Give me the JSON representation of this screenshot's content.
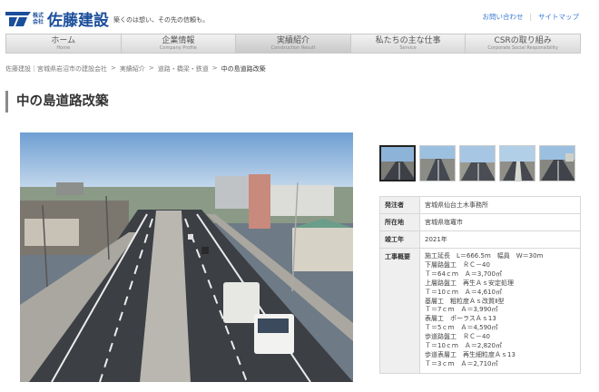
{
  "header": {
    "logo_small": "株式会社",
    "logo_name": "佐藤建設",
    "tagline": "築くのは想い、その先の信頼も。",
    "links": [
      "お問い合わせ",
      "サイトマップ"
    ]
  },
  "nav": [
    {
      "label": "ホーム",
      "sub": "Home"
    },
    {
      "label": "企業情報",
      "sub": "Company Profile"
    },
    {
      "label": "実績紹介",
      "sub": "Construction Result"
    },
    {
      "label": "私たちの主な仕事",
      "sub": "Service"
    },
    {
      "label": "CSRの取り組み",
      "sub": "Corporate Social Responsibility"
    }
  ],
  "breadcrumb": {
    "items": [
      "佐藤建設｜宮城県岩沼市の建設会社",
      "実績紹介",
      "道路・橋梁・鉄道"
    ],
    "current": "中の島道路改築",
    "separator": ">"
  },
  "page_title": "中の島道路改築",
  "project": {
    "rows": [
      {
        "key": "発注者",
        "value": "宮城県仙台土木事務所"
      },
      {
        "key": "所在地",
        "value": "宮城県塩竈市"
      },
      {
        "key": "竣工年",
        "value": "2021年"
      }
    ],
    "overview_key": "工事概要",
    "overview_lines": [
      "施工延長　L＝666.5m　幅員　W＝30m",
      "下層路盤工　ＲＣ－40",
      "Ｔ＝64ｃｍ　Ａ＝3,700㎡",
      "上層路盤工　再生Ａｓ安定処理",
      "Ｔ＝10ｃｍ　Ａ＝4,610㎡",
      "基層工　粗粒度Ａｓ改質Ⅱ型",
      "Ｔ＝7ｃｍ　Ａ＝3,990㎡",
      "表層工　ポーラスＡｓ13",
      "Ｔ＝5ｃｍ　Ａ＝4,590㎡",
      "歩道路盤工　ＲＣ－40",
      "Ｔ＝10ｃｍ　Ａ＝2,820㎡",
      "歩道表層工　再生細粒度Ａｓ13",
      "Ｔ＝3ｃｍ　Ａ＝2,710㎡"
    ]
  },
  "colors": {
    "brand": "#1b4e9b",
    "link": "#3a7bd5"
  }
}
